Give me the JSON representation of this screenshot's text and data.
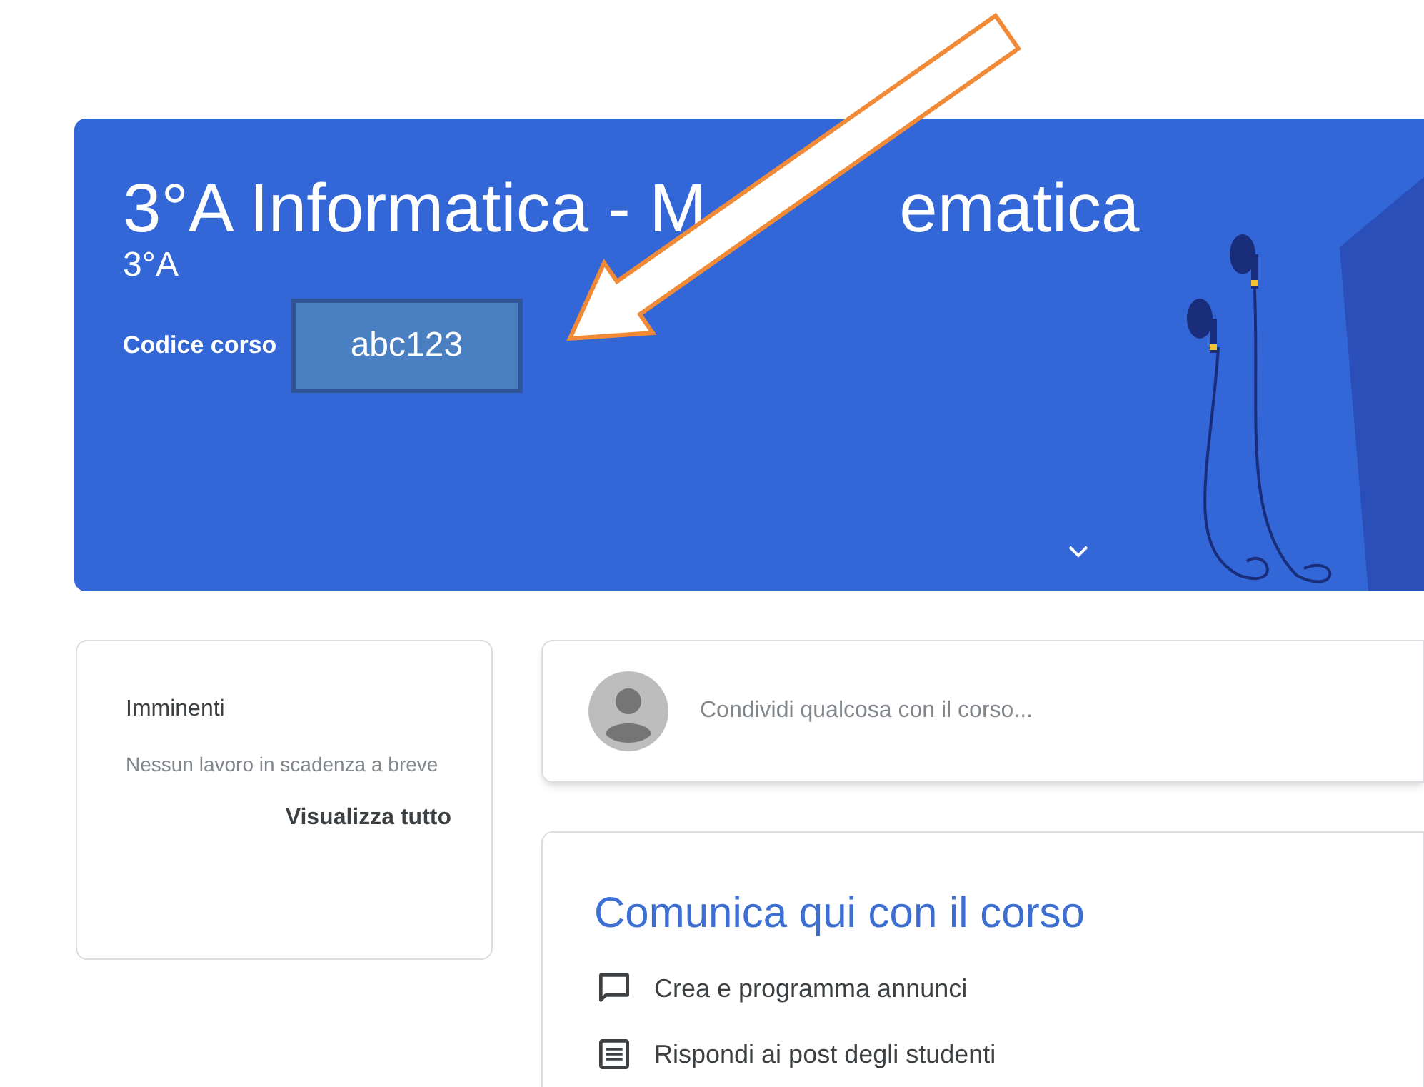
{
  "banner": {
    "title_start": "3°A Informatica - M",
    "title_end": "ematica",
    "section": "3°A",
    "code_label": "Codice corso",
    "code": "abc123"
  },
  "upcoming": {
    "title": "Imminenti",
    "message": "Nessun lavoro in scadenza a breve",
    "link": "Visualizza tutto"
  },
  "share": {
    "placeholder": "Condividi qualcosa con il corso..."
  },
  "communicate": {
    "title": "Comunica qui con il corso",
    "items": [
      {
        "kind": "announce",
        "label": "Crea e programma annunci"
      },
      {
        "kind": "reply",
        "label": "Rispondi ai post degli studenti"
      }
    ]
  }
}
